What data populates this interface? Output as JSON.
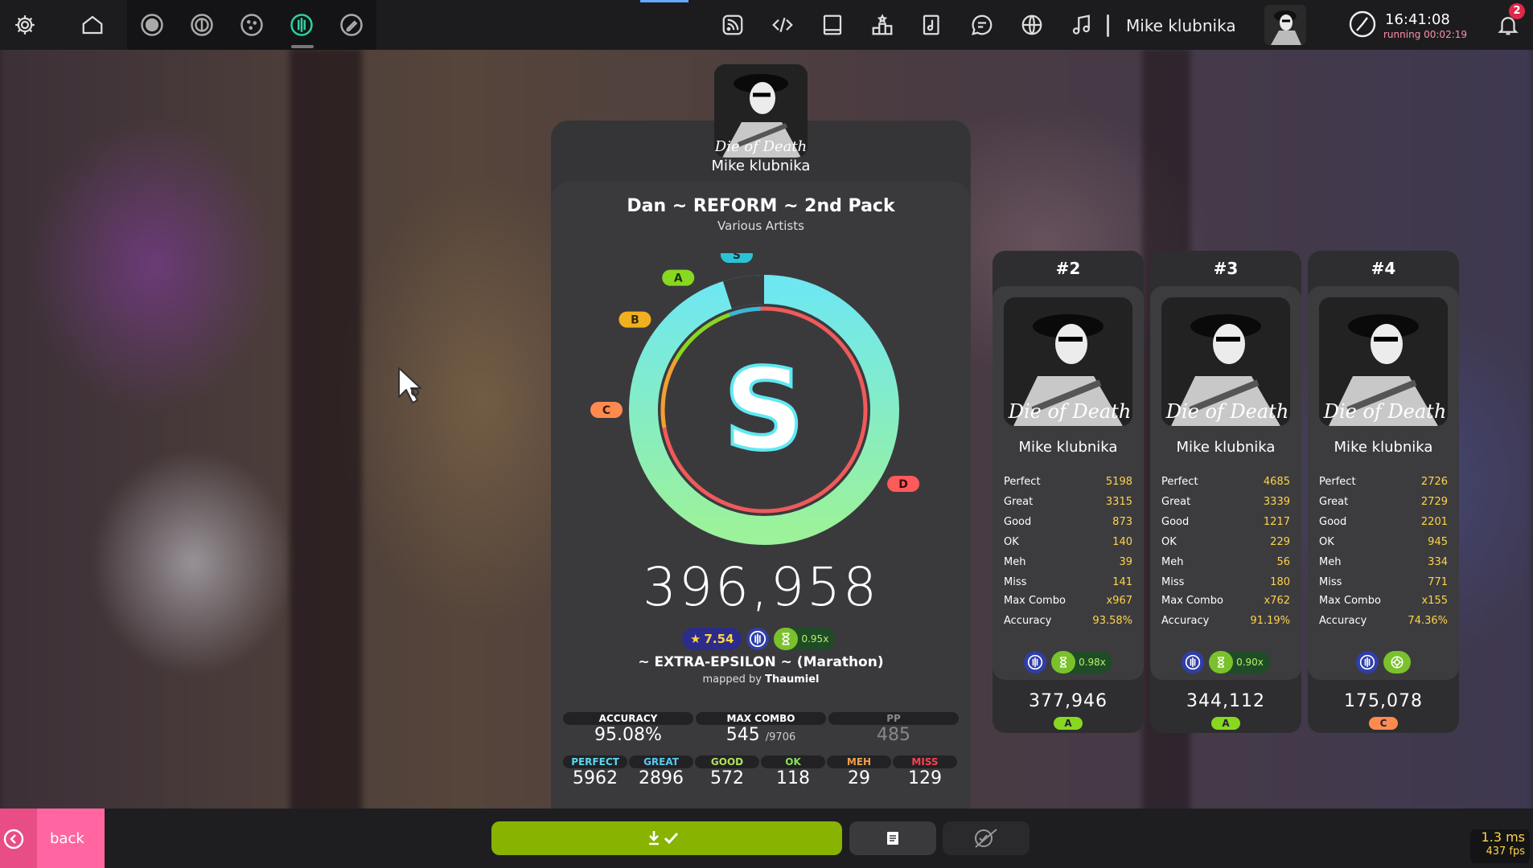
{
  "toolbar": {
    "user_name": "Mike klubnika",
    "clock_time": "16:41:08",
    "clock_running": "running 00:02:19",
    "notification_count": "2",
    "accent": "#66aaff"
  },
  "result": {
    "player_name": "Mike klubnika",
    "title": "Dan ~ REFORM ~ 2nd Pack",
    "artist": "Various Artists",
    "grade": "S",
    "grade_markers": [
      "S",
      "A",
      "B",
      "C",
      "D"
    ],
    "accuracy_fraction": 0.9508,
    "total_score": "396,958",
    "star_rating": "7.54",
    "speed_mod": "0.95x",
    "difficulty": "~ EXTRA-EPSILON ~ (Marathon)",
    "mapped_by_label": "mapped by",
    "mapper": "Thaumiel",
    "stats": {
      "accuracy_label": "ACCURACY",
      "accuracy_value": "95.08%",
      "max_combo_label": "MAX COMBO",
      "max_combo_value": "545",
      "max_combo_total": "/9706",
      "pp_label": "PP",
      "pp_value": "485"
    },
    "judgements": [
      {
        "label": "PERFECT",
        "value": "5962",
        "color": "#58d8f0"
      },
      {
        "label": "GREAT",
        "value": "2896",
        "color": "#58c8f0"
      },
      {
        "label": "GOOD",
        "value": "572",
        "color": "#b2e05a"
      },
      {
        "label": "OK",
        "value": "118",
        "color": "#88e05a"
      },
      {
        "label": "MEH",
        "value": "29",
        "color": "#f0a050"
      },
      {
        "label": "MISS",
        "value": "129",
        "color": "#ff4050"
      }
    ]
  },
  "leaderboard": [
    {
      "rank": "#2",
      "name": "Mike klubnika",
      "score": "377,946",
      "grade": "A",
      "grade_color": "#88d820",
      "mod_speed": "0.98x",
      "rows": [
        {
          "label": "Perfect",
          "value": "5198"
        },
        {
          "label": "Great",
          "value": "3315"
        },
        {
          "label": "Good",
          "value": "873"
        },
        {
          "label": "OK",
          "value": "140"
        },
        {
          "label": "Meh",
          "value": "39"
        },
        {
          "label": "Miss",
          "value": "141"
        }
      ],
      "max_combo_label": "Max Combo",
      "max_combo": "x967",
      "accuracy_label": "Accuracy",
      "accuracy": "93.58%"
    },
    {
      "rank": "#3",
      "name": "Mike klubnika",
      "score": "344,112",
      "grade": "A",
      "grade_color": "#88d820",
      "mod_speed": "0.90x",
      "rows": [
        {
          "label": "Perfect",
          "value": "4685"
        },
        {
          "label": "Great",
          "value": "3339"
        },
        {
          "label": "Good",
          "value": "1217"
        },
        {
          "label": "OK",
          "value": "229"
        },
        {
          "label": "Meh",
          "value": "56"
        },
        {
          "label": "Miss",
          "value": "180"
        }
      ],
      "max_combo_label": "Max Combo",
      "max_combo": "x762",
      "accuracy_label": "Accuracy",
      "accuracy": "91.19%"
    },
    {
      "rank": "#4",
      "name": "Mike klubnika",
      "score": "175,078",
      "grade": "C",
      "grade_color": "#ff8a50",
      "mod_speed": "",
      "rows": [
        {
          "label": "Perfect",
          "value": "2726"
        },
        {
          "label": "Great",
          "value": "2729"
        },
        {
          "label": "Good",
          "value": "2201"
        },
        {
          "label": "OK",
          "value": "945"
        },
        {
          "label": "Meh",
          "value": "334"
        },
        {
          "label": "Miss",
          "value": "771"
        }
      ],
      "max_combo_label": "Max Combo",
      "max_combo": "x155",
      "accuracy_label": "Accuracy",
      "accuracy": "74.36%"
    }
  ],
  "bottom": {
    "back_label": "back",
    "fps_ms": "1.3 ms",
    "fps_value": "437 fps"
  },
  "cover_caption": "Die of Death"
}
